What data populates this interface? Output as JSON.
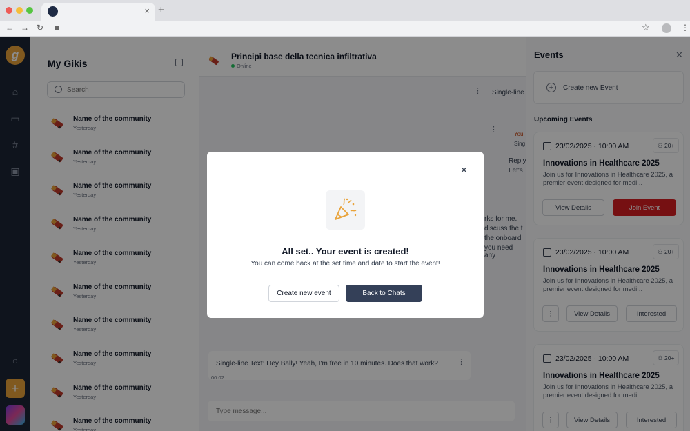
{
  "browser": {
    "tab_close": "×",
    "new_tab": "+",
    "back": "←",
    "forward": "→",
    "reload": "↻",
    "star": "☆",
    "menu": "⋮"
  },
  "rail": {
    "logo": "g",
    "icons": [
      "home-icon",
      "chat-icon",
      "hash-icon",
      "gift-icon",
      "search-icon"
    ]
  },
  "sidebar": {
    "title": "My Gikis",
    "search_placeholder": "Search",
    "communities": [
      {
        "name": "Name of the community",
        "date": "Yesterday"
      },
      {
        "name": "Name of the community",
        "date": "Yesterday"
      },
      {
        "name": "Name of the community",
        "date": "Yesterday"
      },
      {
        "name": "Name of the community",
        "date": "Yesterday"
      },
      {
        "name": "Name of the community",
        "date": "Yesterday"
      },
      {
        "name": "Name of the community",
        "date": "Yesterday"
      },
      {
        "name": "Name of the community",
        "date": "Yesterday"
      },
      {
        "name": "Name of the community",
        "date": "Yesterday"
      },
      {
        "name": "Name of the community",
        "date": "Yesterday"
      },
      {
        "name": "Name of the community",
        "date": "Yesterday"
      }
    ]
  },
  "chat": {
    "title": "Principi base della tecnica infiltrativa",
    "status": "Online",
    "right_messages": [
      "Single-line",
      "You",
      "Sing",
      "Reply",
      "Let's",
      "rks for me.",
      "discuss the t",
      "the onboard",
      "you need any"
    ],
    "last_message": "Single-line Text: Hey Bally! Yeah, I'm free in 10 minutes. Does that work?",
    "last_time": "00:02",
    "composer_placeholder": "Type message..."
  },
  "events": {
    "title": "Events",
    "create_label": "Create new Event",
    "upcoming_label": "Upcoming Events",
    "cards": [
      {
        "date": "23/02/2025",
        "time": "10:00 AM",
        "count": "20+",
        "name": "Innovations in Healthcare 2025",
        "desc": "Join us for Innovations in Healthcare 2025, a premier event designed for medi...",
        "btn1": "View Details",
        "btn2": "Join Event"
      },
      {
        "date": "23/02/2025",
        "time": "10:00 AM",
        "count": "20+",
        "name": "Innovations in Healthcare 2025",
        "desc": "Join us for Innovations in Healthcare 2025, a premier event designed for medi...",
        "btn1": "View Details",
        "btn2": "Interested"
      },
      {
        "date": "23/02/2025",
        "time": "10:00 AM",
        "count": "20+",
        "name": "Innovations in Healthcare 2025",
        "desc": "Join us for Innovations in Healthcare 2025, a premier event designed for medi...",
        "btn1": "View Details",
        "btn2": "Interested"
      }
    ]
  },
  "modal": {
    "title": "All set.. Your event is created!",
    "subtitle": "You can come back at the set time and date to start the event!",
    "secondary_button": "Create new event",
    "primary_button": "Back to Chats"
  }
}
